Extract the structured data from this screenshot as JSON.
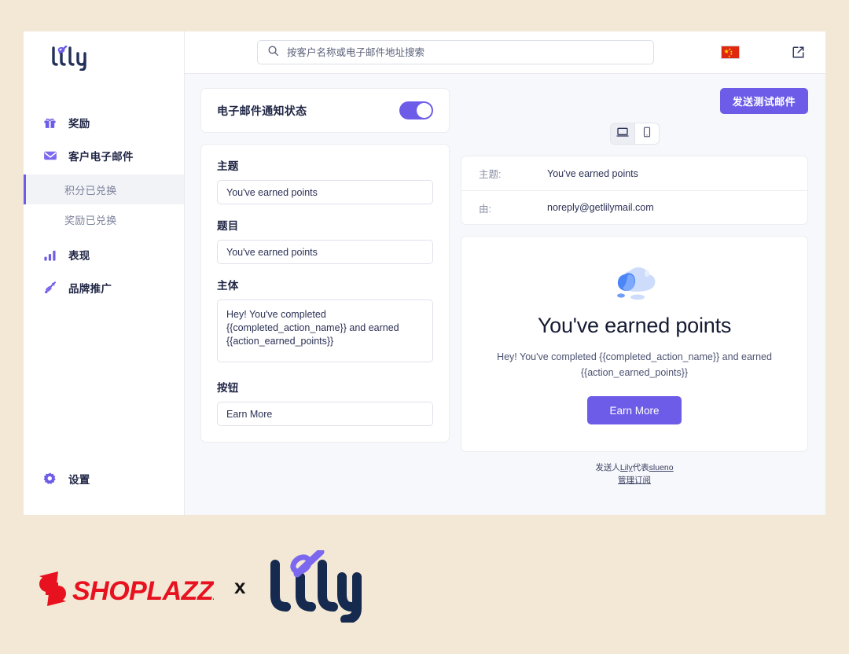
{
  "brand": {
    "name": "lily"
  },
  "sidebar": {
    "items": [
      {
        "label": "奖励",
        "icon": "gift-icon"
      },
      {
        "label": "客户电子邮件",
        "icon": "mail-icon"
      }
    ],
    "sub_items": [
      {
        "label": "积分已兑换",
        "active": true
      },
      {
        "label": "奖励已兑换",
        "active": false
      }
    ],
    "items_after": [
      {
        "label": "表现",
        "icon": "bar-chart-icon"
      },
      {
        "label": "品牌推广",
        "icon": "megaphone-icon"
      }
    ],
    "bottom": {
      "label": "设置",
      "icon": "gear-icon"
    }
  },
  "topbar": {
    "search_placeholder": "按客户名称或电子邮件地址搜索",
    "search_value": "",
    "locale_flag": "china-flag-icon",
    "external_link": "external-link-icon"
  },
  "status_card": {
    "label": "电子邮件通知状态",
    "enabled": true
  },
  "form": {
    "subject_label": "主题",
    "subject_value": "You've earned points",
    "title_label": "题目",
    "title_value": "You've earned points",
    "body_label": "主体",
    "body_value": "Hey! You've completed {{completed_action_name}} and earned {{action_earned_points}}",
    "button_label": "按钮",
    "button_value": "Earn More"
  },
  "preview": {
    "send_test_label": "发送测试邮件",
    "device_desktop": "desktop-icon",
    "device_mobile": "mobile-icon",
    "active_device": "desktop",
    "meta": [
      {
        "key": "主题:",
        "value": "You've earned points"
      },
      {
        "key": "由:",
        "value": "noreply@getlilymail.com"
      }
    ],
    "email_title": "You've earned points",
    "email_body": "Hey! You've completed {{completed_action_name}} and earned {{action_earned_points}}",
    "email_button": "Earn More",
    "footer_prefix": "发送人",
    "footer_brand": "Lily",
    "footer_middle": "代表",
    "footer_store": "slueno",
    "footer_manage": "管理订阅"
  },
  "logos": {
    "shoplazza": "SHOPLAZZA",
    "separator": "x",
    "lily": "lily"
  },
  "colors": {
    "accent": "#6c5ce7",
    "page_bg": "#f2e8d5",
    "panel_bg": "#f7f8fb",
    "text_dark": "#1f2544",
    "shoplazza_red": "#e8111f",
    "lily_navy": "#152a4e"
  }
}
